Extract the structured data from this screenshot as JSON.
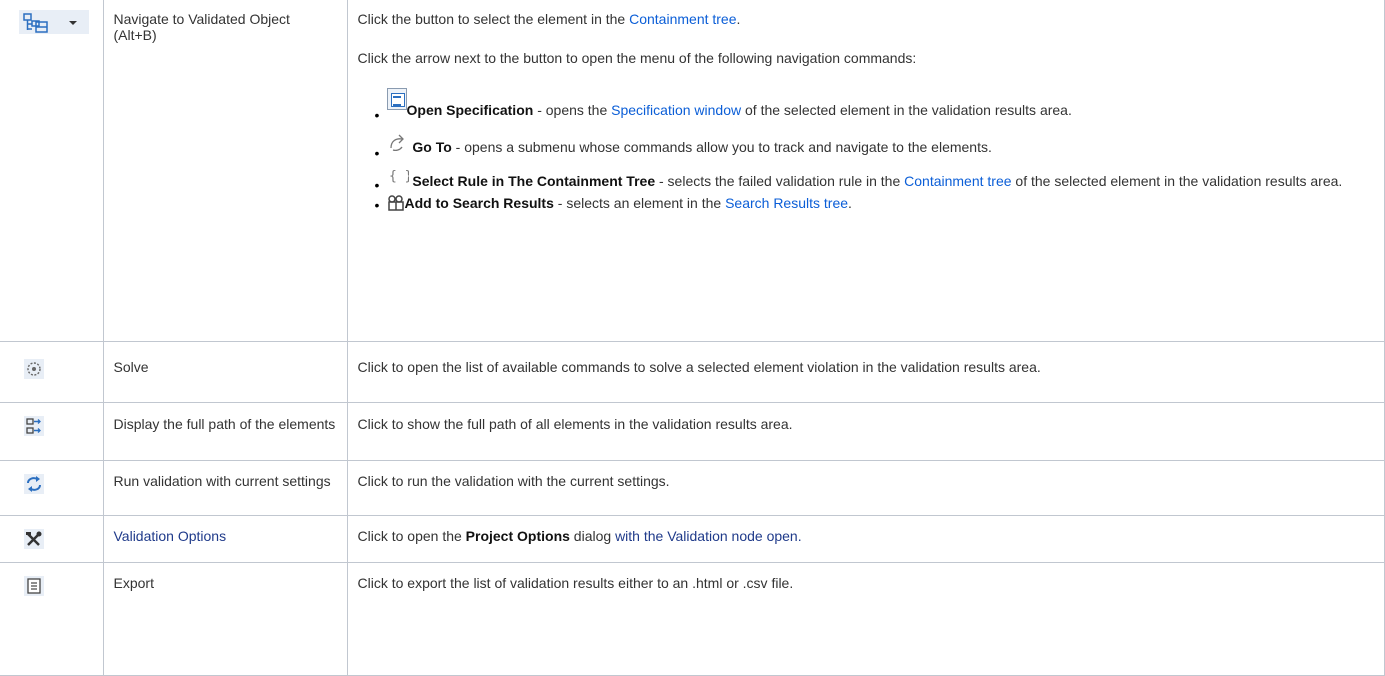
{
  "rows": [
    {
      "name": "Navigate to Validated Object (Alt+B)",
      "icon": "navigate-tree-dropdown-icon",
      "desc": {
        "p1_pre": "Click the button to select the element in the ",
        "p1_link": "Containment tree",
        "p1_post": ".",
        "p2": "Click the arrow next to the button to open the menu of the following navigation commands:",
        "items": [
          {
            "icon": "open-specification-icon",
            "bold": "Open Specification",
            "pre": " - opens the ",
            "link": "Specification window",
            "post": " of the selected element in the validation results area."
          },
          {
            "icon": "go-to-icon",
            "bold": "Go To",
            "pre": " - opens a submenu whose commands allow you to track and navigate to the elements.",
            "link": "",
            "post": ""
          },
          {
            "icon": "select-rule-braces-icon",
            "bold": "Select Rule in The Containment Tree",
            "pre": " - selects the failed validation rule in the ",
            "link": "Containment tree",
            "post": " of the selected element in the validation results area."
          },
          {
            "icon": "add-to-search-results-icon",
            "bold": "Add to Search Results",
            "pre": " - selects an element in the ",
            "link": "Search Results tree",
            "post": "."
          }
        ]
      }
    },
    {
      "name": "Solve",
      "icon": "solve-icon",
      "desc": "Click to open the list of available commands to solve a selected element violation in the validation results area."
    },
    {
      "name": "Display the full path of the elements",
      "icon": "full-path-icon",
      "desc": "Click to show the full path of all elements in the validation results area."
    },
    {
      "name": "Run validation with current settings",
      "icon": "run-validation-icon",
      "desc": "Click to run the validation with the current settings."
    },
    {
      "name": "Validation Options",
      "icon": "validation-options-tools-icon",
      "desc_pre": "Click to open the ",
      "desc_bold": "Project Options",
      "desc_mid": " dialog ",
      "desc_link": "with the Validation node open."
    },
    {
      "name": "Export",
      "icon": "export-icon",
      "desc": "Click to export the list of validation results either to an .html or .csv file."
    }
  ],
  "colors": {
    "link": "#0b5ed7",
    "border": "#c1c7d0",
    "icon_blue": "#2b6fc0"
  }
}
